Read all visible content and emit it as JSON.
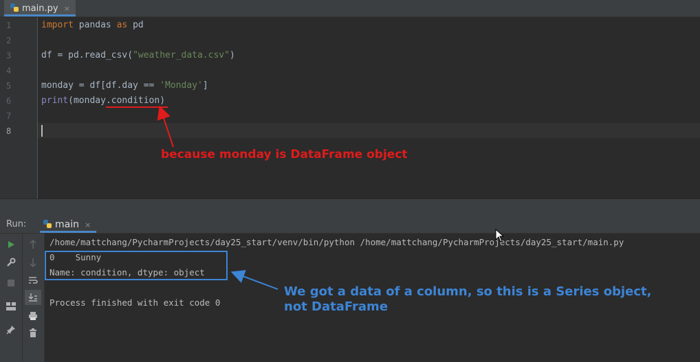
{
  "editor_tab": {
    "filename": "main.py",
    "close": "×"
  },
  "gutter": {
    "lines": [
      "1",
      "2",
      "3",
      "4",
      "5",
      "6",
      "7",
      "8"
    ]
  },
  "code": {
    "l1": {
      "kw1": "import",
      "t1": " pandas ",
      "kw2": "as",
      "t2": " pd"
    },
    "l3": {
      "t1": "df = pd.read_csv(",
      "s1": "\"weather_data.csv\"",
      "t2": ")"
    },
    "l5": {
      "t1": "monday = df[df.day == ",
      "s1": "'Monday'",
      "t2": "]"
    },
    "l6": {
      "fn": "print",
      "t1": "(monday",
      "t2": ".condition",
      "t3": ")"
    }
  },
  "annotations": {
    "red": "because monday is DataFrame object",
    "blue_line1": "We got a data of a column, so this is a Series object,",
    "blue_line2": "not DataFrame",
    "red_color": "#e01b1b",
    "blue_color": "#3d85d6"
  },
  "run_panel": {
    "label": "Run:",
    "tab": "main",
    "close": "×"
  },
  "console": {
    "command": "/home/mattchang/PycharmProjects/day25_start/venv/bin/python /home/mattchang/PycharmProjects/day25_start/main.py",
    "out1": "0    Sunny",
    "out2": "Name: condition, dtype: object",
    "exit": "Process finished with exit code 0"
  },
  "icons": {
    "python_file": "python-icon",
    "run": "play-icon",
    "settings": "wrench-icon",
    "stop": "stop-icon",
    "layout": "layout-icon",
    "pin": "pin-icon",
    "up": "arrow-up-icon",
    "down": "arrow-down-icon",
    "wrap": "soft-wrap-icon",
    "scroll": "scroll-to-end-icon",
    "print": "print-icon",
    "trash": "trash-icon"
  }
}
